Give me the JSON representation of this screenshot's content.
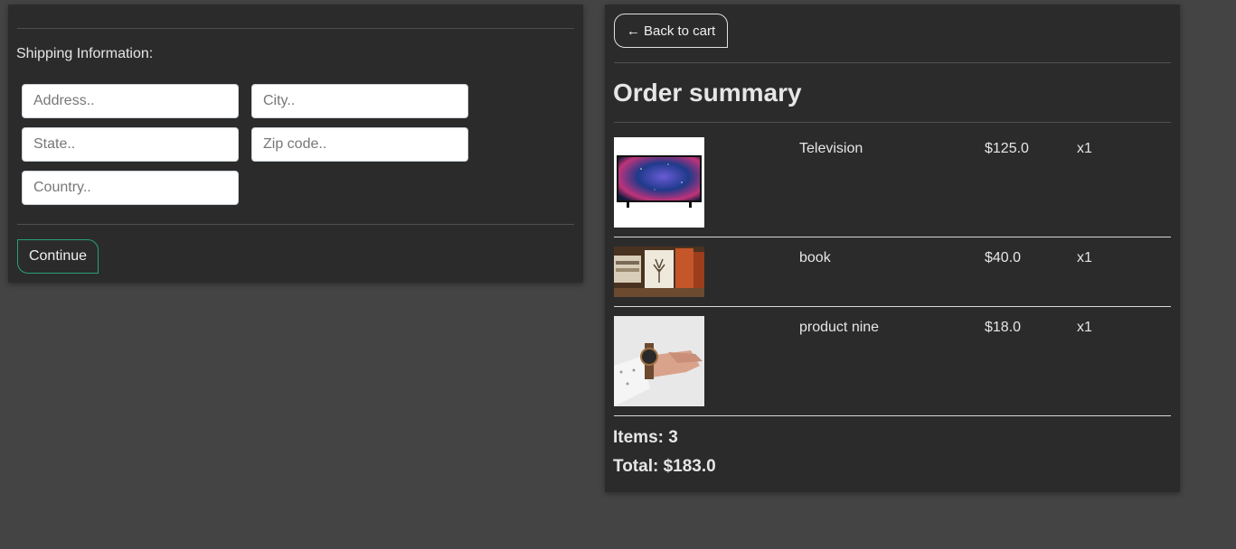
{
  "shipping": {
    "heading": "Shipping Information:",
    "address_placeholder": "Address..",
    "city_placeholder": "City..",
    "state_placeholder": "State..",
    "zip_placeholder": "Zip code..",
    "country_placeholder": "Country..",
    "continue_label": "Continue"
  },
  "summary": {
    "back_label": "← Back to cart",
    "title": "Order summary",
    "items": [
      {
        "name": "Television",
        "price": "$125.0",
        "qty": "x1",
        "image": "television-image"
      },
      {
        "name": "book",
        "price": "$40.0",
        "qty": "x1",
        "image": "books-image"
      },
      {
        "name": "product nine",
        "price": "$18.0",
        "qty": "x1",
        "image": "wristwatch-image"
      }
    ],
    "items_count": "Items: 3",
    "total": "Total: $183.0"
  },
  "colors": {
    "background": "#444444",
    "panel": "#2b2b2b",
    "continue_border": "#28a07a"
  }
}
